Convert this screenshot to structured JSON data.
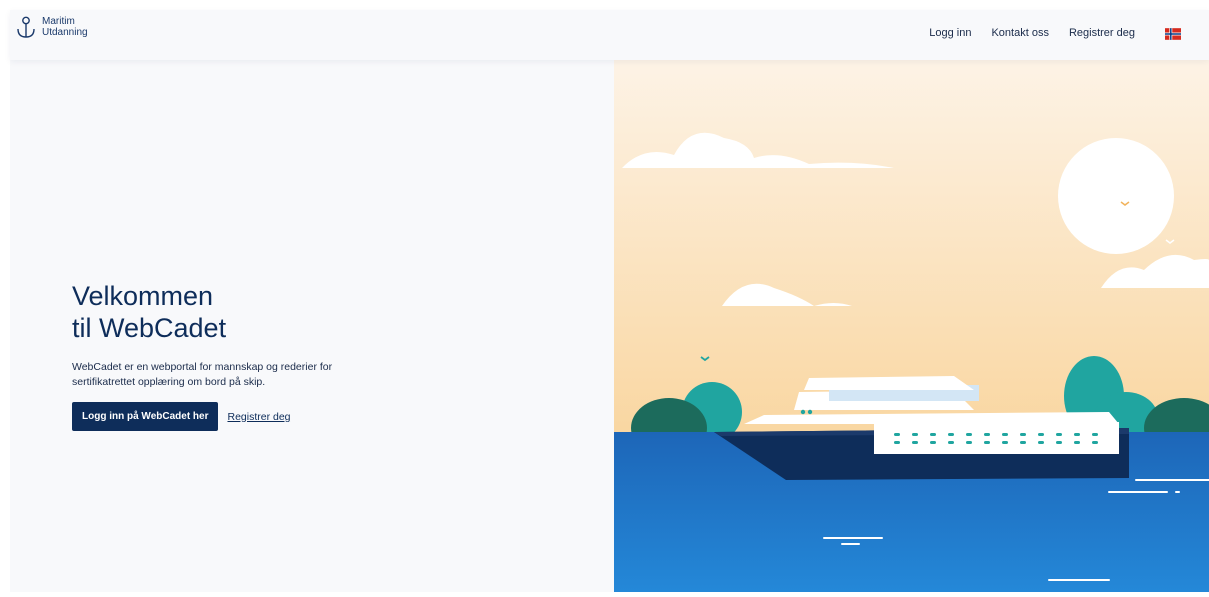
{
  "brand": {
    "line1": "Maritim",
    "line2": "Utdanning"
  },
  "nav": {
    "login": "Logg inn",
    "contact": "Kontakt oss",
    "register": "Registrer deg",
    "language_icon": "norwegian-flag-icon"
  },
  "hero": {
    "title_line1": "Velkommen",
    "title_line2": "til WebCadet",
    "description": "WebCadet er en webportal for mannskap og rederier for sertifikatrettet opplæring om bord på skip.",
    "primary_button": "Logg inn på WebCadet her",
    "secondary_link": "Registrer deg"
  },
  "colors": {
    "primary": "#0e2d5a",
    "sky_top": "#fdf3e6",
    "sky_bottom": "#f9d9a6",
    "sea": "#1e74c4",
    "teal": "#20a5a0"
  }
}
